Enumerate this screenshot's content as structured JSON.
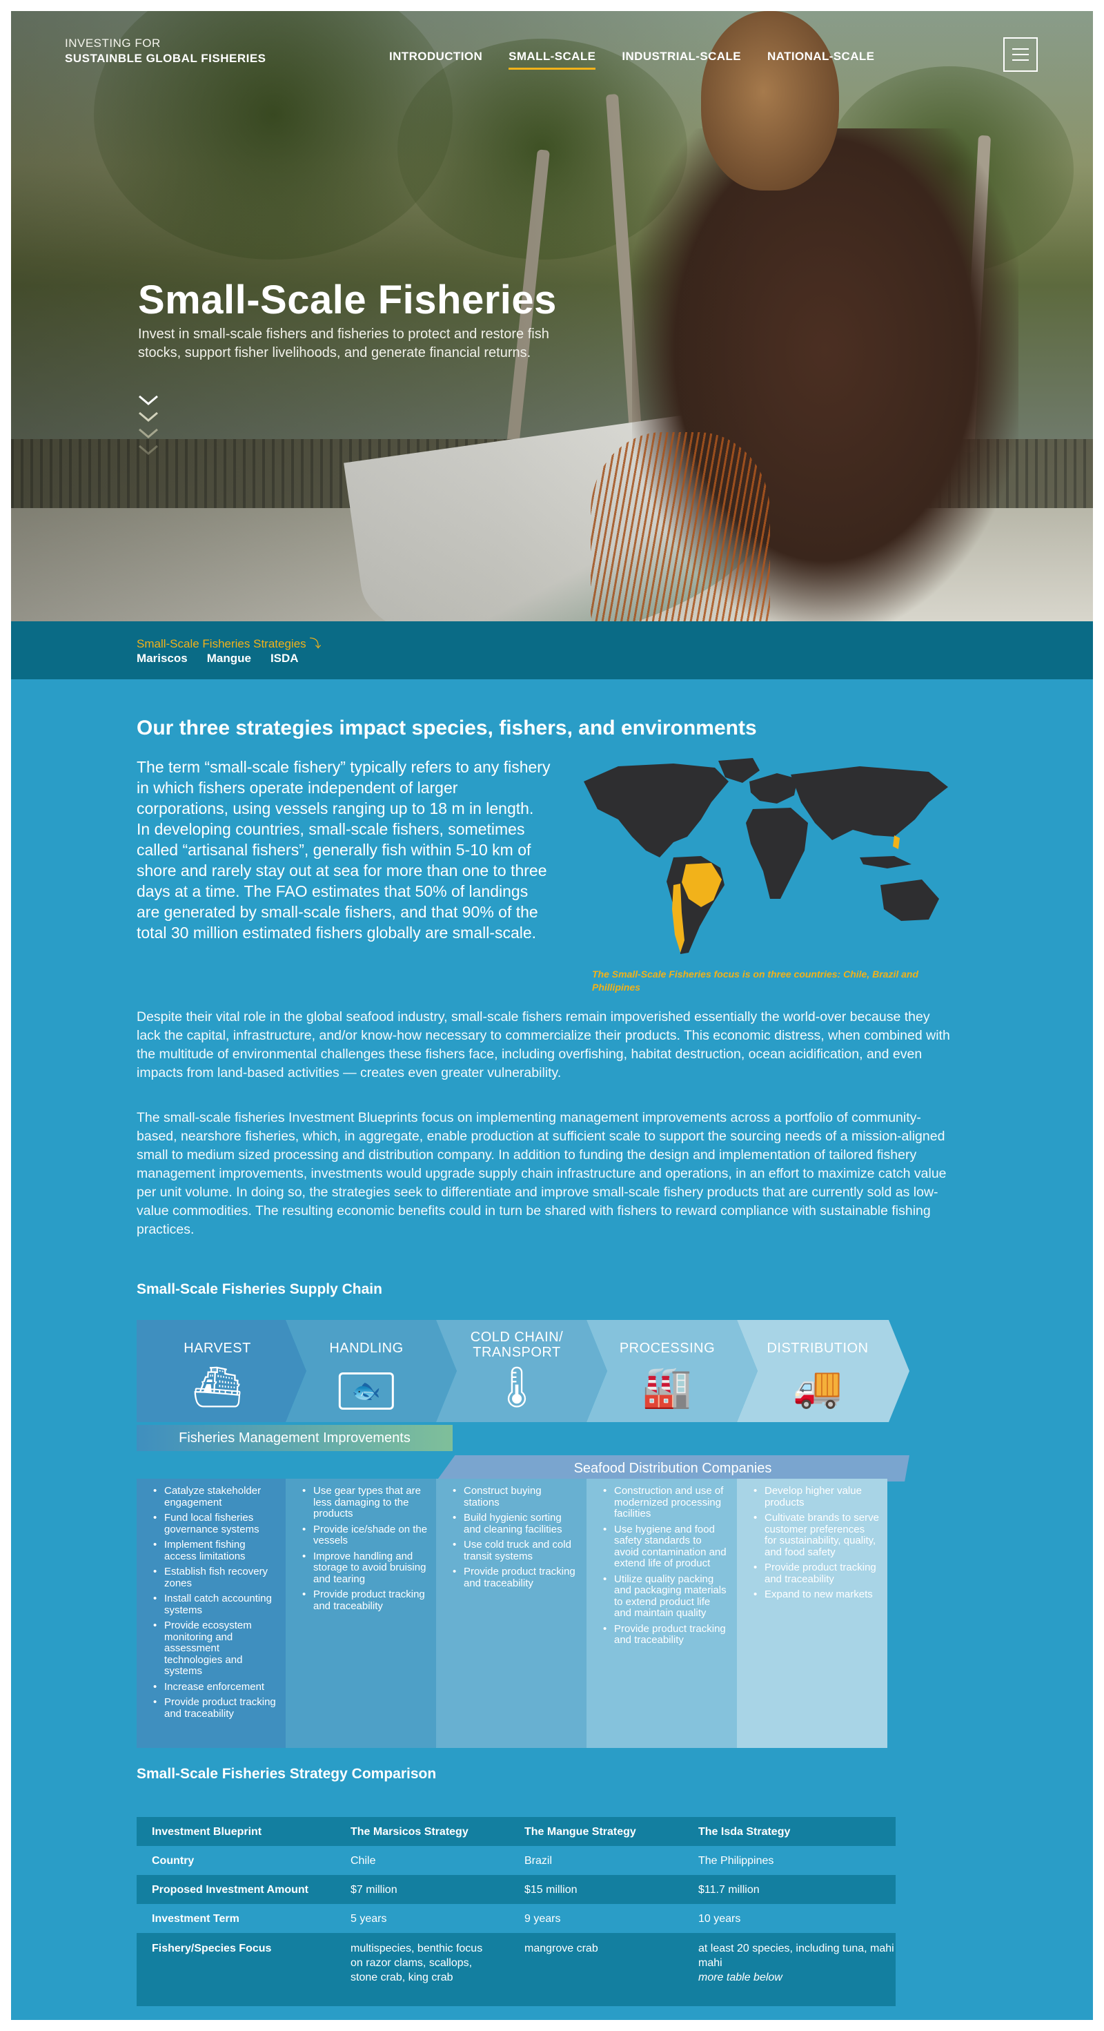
{
  "header": {
    "brand_line1": "INVESTING FOR",
    "brand_line2": "SUSTAINBLE GLOBAL FISHERIES",
    "nav": [
      "INTRODUCTION",
      "SMALL-SCALE",
      "INDUSTRIAL-SCALE",
      "NATIONAL-SCALE"
    ],
    "active_nav": "SMALL-SCALE"
  },
  "hero": {
    "title": "Small-Scale Fisheries",
    "subtitle": "Invest in small-scale fishers and fisheries to protect and restore fish stocks, support fisher livelihoods, and generate financial returns."
  },
  "strategies_nav": {
    "label": "Small-Scale Fisheries Strategies ⤵",
    "links": [
      "Mariscos",
      "Mangue",
      "ISDA"
    ]
  },
  "content": {
    "heading": "Our three strategies impact species, fishers, and environments",
    "lead": "The term “small-scale fishery” typically refers to any fishery in which fishers operate independent of larger corporations, using vessels ranging up to 18 m in length. In developing countries, small-scale fishers, sometimes called “artisanal fishers”, generally fish within 5-10 km of shore and rarely stay out at sea for more than one to three days at a time. The FAO estimates that 50% of landings are generated by small-scale fishers, and that 90% of the total 30 million estimated fishers globally are small-scale.",
    "map_caption": "The Small-Scale Fisheries focus is on three countries: Chile, Brazil and Phillipines",
    "para1": "Despite their vital role in the global seafood industry, small-scale fishers remain impoverished essentially the world-over because they lack the capital, infrastructure, and/or know-how necessary to commercialize their products. This economic distress, when combined with the multitude of environmental challenges these fishers face, including overfishing, habitat destruction, ocean acidification, and even impacts from land-based activities — creates even greater vulnerability.",
    "para2": "The small-scale fisheries Investment Blueprints focus on implementing management improvements across a portfolio of community-based, nearshore fisheries, which, in aggregate, enable production at sufficient scale to support the sourcing needs of a mission-aligned small to medium sized processing and distribution company. In addition to funding the design and implementation of tailored fishery management improvements, investments would upgrade supply chain infrastructure and operations, in an effort to maximize catch value per unit volume. In doing so, the strategies seek to differentiate and improve small-scale fishery products that are currently sold as low-value commodities. The resulting economic benefits could in turn be shared with fishers to reward compliance with sustainable fishing practices."
  },
  "supply_chain": {
    "heading": "Small-Scale Fisheries Supply Chain",
    "stages": [
      {
        "title": "HARVEST",
        "icon": "boat-icon",
        "glyph": "⛴",
        "color": "#3f8fbf"
      },
      {
        "title": "HANDLING",
        "icon": "fish-cooler-icon",
        "glyph": "🐟",
        "color": "#4ea0c7"
      },
      {
        "title": "COLD CHAIN/\nTRANSPORT",
        "icon": "thermometer-icon",
        "glyph": "🌡",
        "color": "#68b0d1"
      },
      {
        "title": "PROCESSING",
        "icon": "factory-icon",
        "glyph": "🏭",
        "color": "#85c2dc"
      },
      {
        "title": "DISTRIBUTION",
        "icon": "truck-icon",
        "glyph": "🚚",
        "color": "#a8d4e6"
      }
    ],
    "bar_fisheries": "Fisheries Management Improvements",
    "bar_seafood": "Seafood Distribution Companies",
    "columns": [
      [
        "Catalyze stakeholder engagement",
        "Fund local fisheries governance systems",
        "Implement fishing access limitations",
        "Establish fish recovery zones",
        "Install catch accounting systems",
        "Provide ecosystem monitoring and assessment technologies and systems",
        "Increase enforcement",
        "Provide product tracking and traceability"
      ],
      [
        "Use gear types that are less damaging to the products",
        "Provide ice/shade on the vessels",
        "Improve handling and storage to avoid bruising and tearing",
        "Provide product tracking and traceability"
      ],
      [
        "Construct buying stations",
        "Build hygienic sorting and cleaning facilities",
        "Use cold truck and cold transit systems",
        "Provide product tracking and traceability"
      ],
      [
        "Construction and use of modernized processing facilities",
        "Use hygiene and food safety standards to avoid contamination and extend life of product",
        "Utilize quality packing and packaging materials to extend product life and maintain quality",
        "Provide product tracking and traceability"
      ],
      [
        "Develop higher value products",
        "Cultivate brands to serve customer preferences for sustainability, quality, and food safety",
        "Provide product tracking and traceability",
        "Expand to new markets"
      ]
    ]
  },
  "comparison": {
    "heading": "Small-Scale Fisheries Strategy Comparison",
    "header": [
      "Investment Blueprint",
      "The Marsicos Strategy",
      "The Mangue Strategy",
      "The Isda Strategy"
    ],
    "rows": [
      [
        "Country",
        "Chile",
        "Brazil",
        "The Philippines"
      ],
      [
        "Proposed Investment Amount",
        "$7 million",
        "$15 million",
        "$11.7 million"
      ],
      [
        "Investment Term",
        "5 years",
        "9 years",
        "10 years"
      ],
      [
        "Fishery/Species Focus",
        "multispecies, benthic focus on razor clams, scallops, stone crab, king crab",
        "mangrove crab",
        "at least 20 species, including tuna, mahi mahi"
      ]
    ],
    "more_note": "more table below"
  },
  "colors": {
    "accent": "#f2b21a",
    "page_blue": "#2a9dc7",
    "band_blue": "#0a6b86",
    "map_land": "#2e2e30",
    "highlight_land": "#f2b21a"
  }
}
